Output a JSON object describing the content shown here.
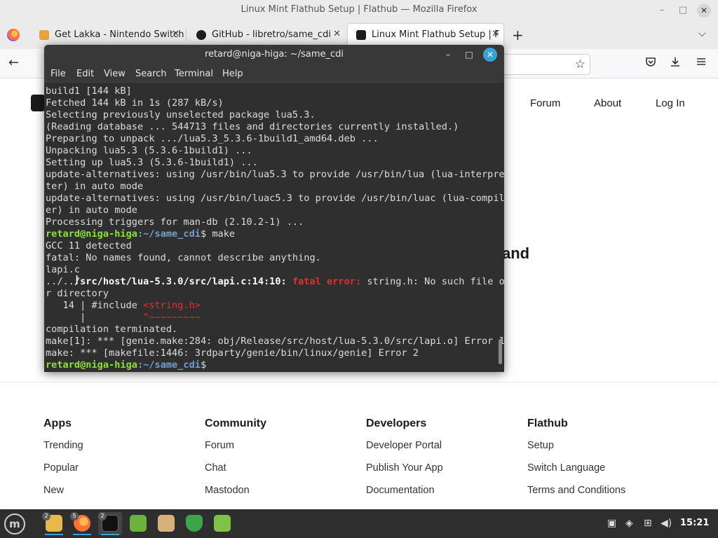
{
  "firefox": {
    "window_title": "Linux Mint Flathub Setup | Flathub — Mozilla Firefox",
    "tabs": [
      {
        "label": "Get Lakka - Nintendo Switch",
        "color": "#e8a33a"
      },
      {
        "label": "GitHub - libretro/same_cdi",
        "color": "#1d1d1d"
      },
      {
        "label": "Linux Mint Flathub Setup | F",
        "color": "#1d1d1d"
      }
    ],
    "tab_close": "✕",
    "newtab": "+",
    "tablist": "⌵",
    "back": "←",
    "star": "☆",
    "win_min": "–",
    "win_max": "□",
    "win_close": "✕"
  },
  "site": {
    "nav": [
      "Forum",
      "About",
      "Log In"
    ],
    "hero_fragment": "and",
    "footer": [
      {
        "heading": "Apps",
        "links": [
          "Trending",
          "Popular",
          "New"
        ]
      },
      {
        "heading": "Community",
        "links": [
          "Forum",
          "Chat",
          "Mastodon"
        ]
      },
      {
        "heading": "Developers",
        "links": [
          "Developer Portal",
          "Publish Your App",
          "Documentation"
        ]
      },
      {
        "heading": "Flathub",
        "links": [
          "Setup",
          "Switch Language",
          "Terms and Conditions"
        ]
      }
    ]
  },
  "terminal": {
    "title": "retard@niga-higa: ~/same_cdi",
    "menu": [
      "File",
      "Edit",
      "View",
      "Search",
      "Terminal",
      "Help"
    ],
    "btn_min": "–",
    "btn_max": "□",
    "btn_close": "✕",
    "prompt_user": "retard@niga-higa",
    "prompt_path": ":~/same_cdi",
    "prompt_symbol": "$",
    "cmd_make": " make",
    "lines_a": [
      "build1 [144 kB]",
      "Fetched 144 kB in 1s (287 kB/s)",
      "Selecting previously unselected package lua5.3.",
      "(Reading database ... 544713 files and directories currently installed.)",
      "Preparing to unpack .../lua5.3_5.3.6-1build1_amd64.deb ...",
      "Unpacking lua5.3 (5.3.6-1build1) ...",
      "Setting up lua5.3 (5.3.6-1build1) ...",
      "update-alternatives: using /usr/bin/lua5.3 to provide /usr/bin/lua (lua-interpre",
      "ter) in auto mode",
      "update-alternatives: using /usr/bin/luac5.3 to provide /usr/bin/luac (lua-compil",
      "er) in auto mode",
      "Processing triggers for man-db (2.10.2-1) ..."
    ],
    "lines_b": [
      "GCC 11 detected",
      "fatal: No names found, cannot describe anything.",
      "lapi.c"
    ],
    "err_prefix": "../..",
    "err_file": "/src/host/lua-5.3.0/src/lapi.c:14:10:",
    "err_label": " fatal error:",
    "err_msg": " string.h: No such file o",
    "err_cont": "r directory",
    "inc_prefix": "   14 | #include ",
    "inc_file": "<string.h>",
    "caret_prefix": "      |          ",
    "caret": "^~~~~~~~~~",
    "lines_c": [
      "compilation terminated.",
      "make[1]: *** [genie.make:284: obj/Release/src/host/lua-5.3.0/src/lapi.o] Error 1",
      "make: *** [makefile:1446: 3rdparty/genie/bin/linux/genie] Error 2"
    ]
  },
  "taskbar": {
    "menu_glyph": "m",
    "badges": {
      "files": "2",
      "firefox": "5",
      "terminal": "2"
    },
    "clock": "15:21"
  }
}
